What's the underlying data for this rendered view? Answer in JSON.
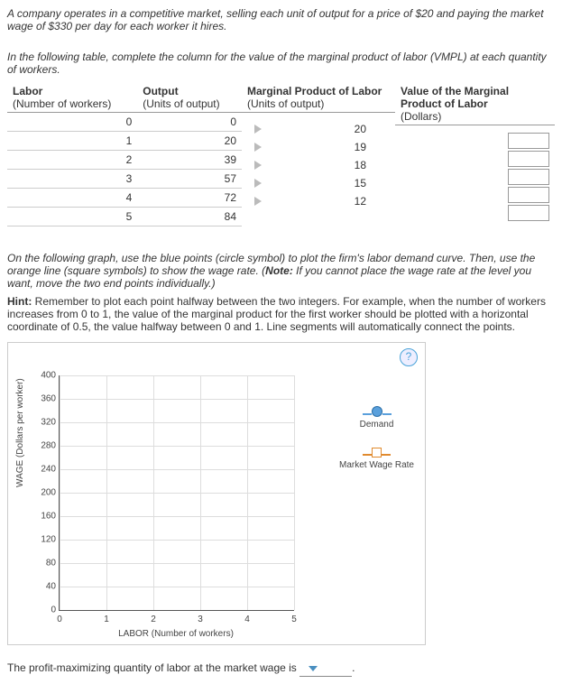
{
  "intro": "A company operates in a competitive market, selling each unit of output for a price of $20 and paying the market wage of $330 per day for each worker it hires.",
  "tableIntro": "In the following table, complete the column for the value of the marginal product of labor (VMPL) at each quantity of workers.",
  "headers": {
    "labor": "Labor",
    "laborSub": "(Number of workers)",
    "output": "Output",
    "outputSub": "(Units of output)",
    "mpl": "Marginal Product of Labor",
    "mplSub": "(Units of output)",
    "vmpl": "Value of the Marginal Product of Labor",
    "vmplSub": "(Dollars)"
  },
  "rows": [
    {
      "labor": "0",
      "output": "0"
    },
    {
      "labor": "1",
      "output": "20"
    },
    {
      "labor": "2",
      "output": "39"
    },
    {
      "labor": "3",
      "output": "57"
    },
    {
      "labor": "4",
      "output": "72"
    },
    {
      "labor": "5",
      "output": "84"
    }
  ],
  "mpl": [
    "20",
    "19",
    "18",
    "15",
    "12"
  ],
  "graphNote1": "On the following graph, use the blue points (circle symbol) to plot the firm's labor demand curve. Then, use the orange line (square symbols) to show the wage rate. (",
  "graphNoteBold": "Note:",
  "graphNote2": " If you cannot place the wage rate at the level you want, move the two end points individually.)",
  "hintLabel": "Hint:",
  "hintText": " Remember to plot each point halfway between the two integers. For example, when the number of workers increases from 0 to 1, the value of the marginal product for the first worker should be plotted with a horizontal coordinate of 0.5, the value halfway between 0 and 1. Line segments will automatically connect the points.",
  "help": "?",
  "chart_data": {
    "type": "line",
    "title": "",
    "xlabel": "LABOR (Number of workers)",
    "ylabel": "WAGE (Dollars per worker)",
    "xlim": [
      0,
      5
    ],
    "ylim": [
      0,
      400
    ],
    "xticks": [
      0,
      1,
      2,
      3,
      4,
      5
    ],
    "yticks": [
      0,
      40,
      80,
      120,
      160,
      200,
      240,
      280,
      320,
      360,
      400
    ],
    "series": [
      {
        "name": "Demand",
        "symbol": "circle",
        "color": "#5aa0dc",
        "values": []
      },
      {
        "name": "Market Wage Rate",
        "symbol": "square",
        "color": "#e08a2e",
        "values": []
      }
    ]
  },
  "legend": {
    "demand": "Demand",
    "wage": "Market Wage Rate"
  },
  "finalQ": "The profit-maximizing quantity of labor at the market wage is",
  "finalBlank": "",
  "period": "."
}
